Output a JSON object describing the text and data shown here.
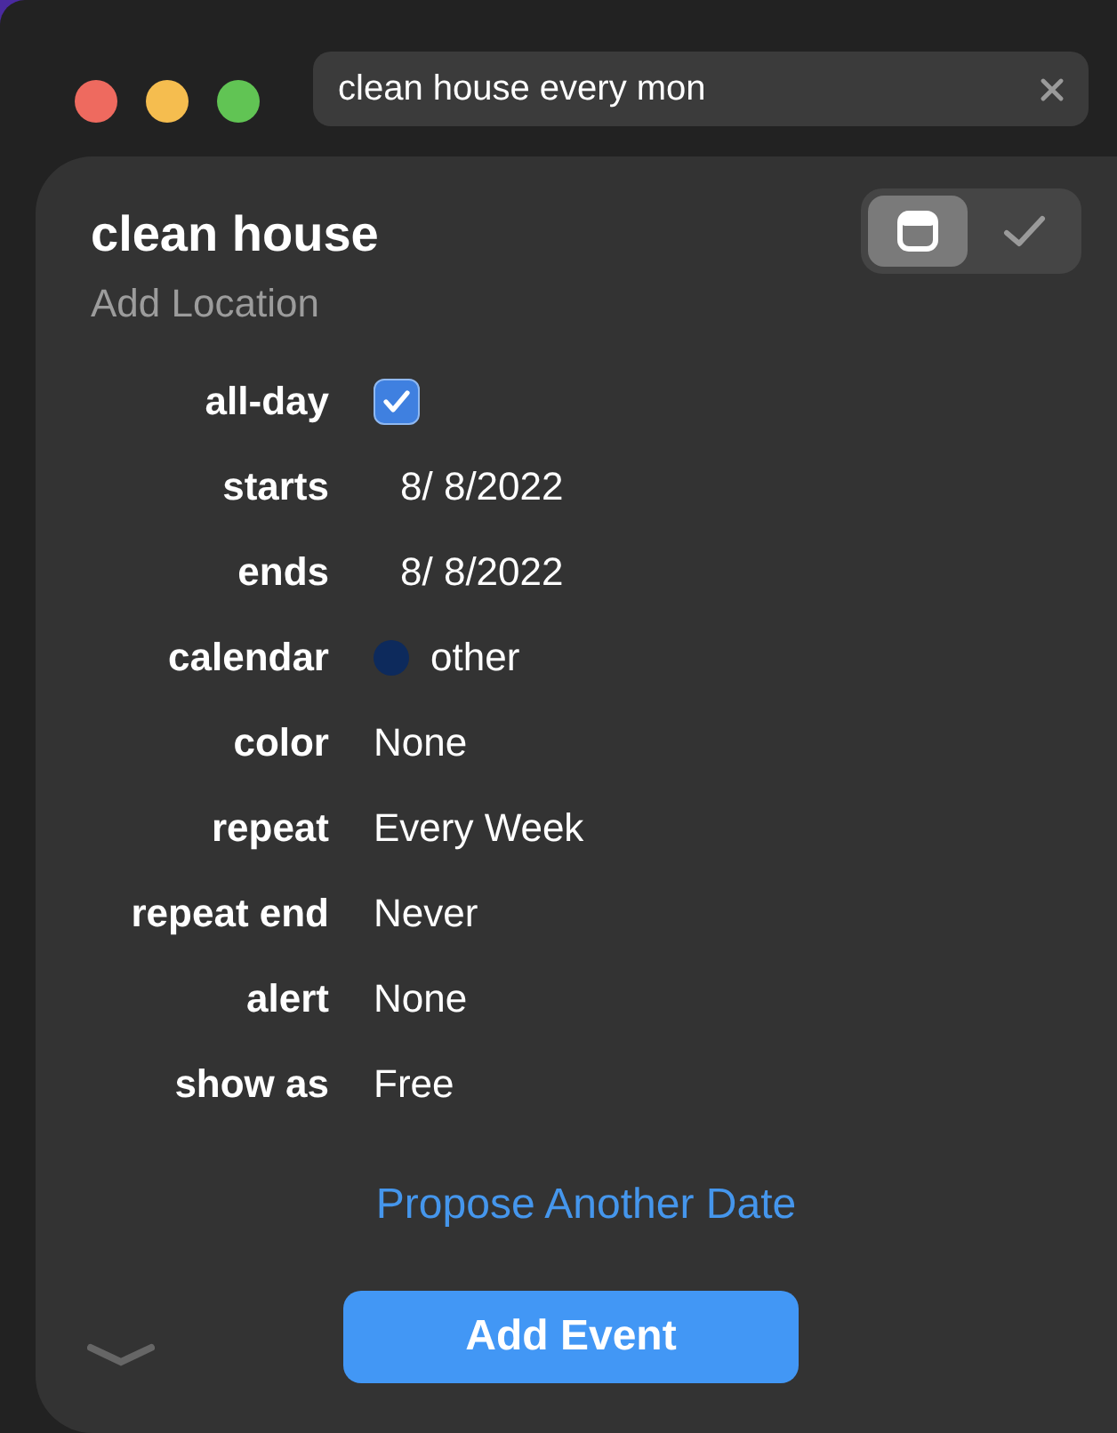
{
  "search": {
    "value": "clean house every mon"
  },
  "event": {
    "title": "clean house",
    "location_placeholder": "Add Location"
  },
  "mode_toggle": [
    {
      "kind": "event",
      "selected": true
    },
    {
      "kind": "reminder",
      "selected": false
    }
  ],
  "fields": [
    {
      "label": "all-day",
      "kind": "checkbox",
      "checked": true
    },
    {
      "label": "starts",
      "kind": "date",
      "value": "8/  8/2022"
    },
    {
      "label": "ends",
      "kind": "date",
      "value": "8/  8/2022"
    },
    {
      "label": "calendar",
      "kind": "calendar",
      "value": "other",
      "color": "#0d2a5c"
    },
    {
      "label": "color",
      "kind": "text",
      "value": "None"
    },
    {
      "label": "repeat",
      "kind": "text",
      "value": "Every Week"
    },
    {
      "label": "repeat end",
      "kind": "text",
      "value": "Never"
    },
    {
      "label": "alert",
      "kind": "text",
      "value": "None"
    },
    {
      "label": "show as",
      "kind": "text",
      "value": "Free"
    }
  ],
  "propose_link": "Propose Another Date",
  "add_button": "Add Event"
}
